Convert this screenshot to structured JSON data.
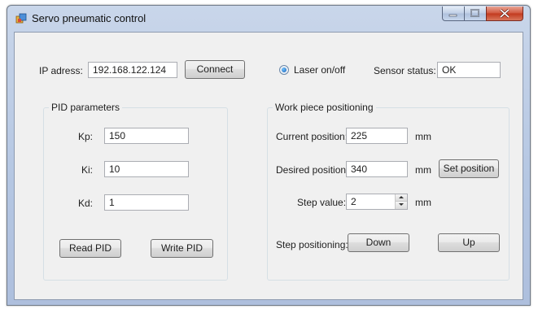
{
  "window": {
    "title": "Servo pneumatic control"
  },
  "connection": {
    "ip_label": "IP adress:",
    "ip_value": "192.168.122.124",
    "connect_label": "Connect"
  },
  "laser": {
    "label": "Laser on/off",
    "checked": true
  },
  "sensor": {
    "label": "Sensor status:",
    "value": "OK"
  },
  "pid": {
    "group_title": "PID parameters",
    "kp_label": "Kp:",
    "kp_value": "150",
    "ki_label": "Ki:",
    "ki_value": "10",
    "kd_label": "Kd:",
    "kd_value": "1",
    "read_label": "Read PID",
    "write_label": "Write PID"
  },
  "workpiece": {
    "group_title": "Work piece positioning",
    "current_label": "Current position:",
    "current_value": "225",
    "current_unit": "mm",
    "desired_label": "Desired position:",
    "desired_value": "340",
    "desired_unit": "mm",
    "set_position_label": "Set position",
    "step_label": "Step value:",
    "step_value": "2",
    "step_unit": "mm",
    "step_positioning_label": "Step positioning:",
    "down_label": "Down",
    "up_label": "Up"
  }
}
